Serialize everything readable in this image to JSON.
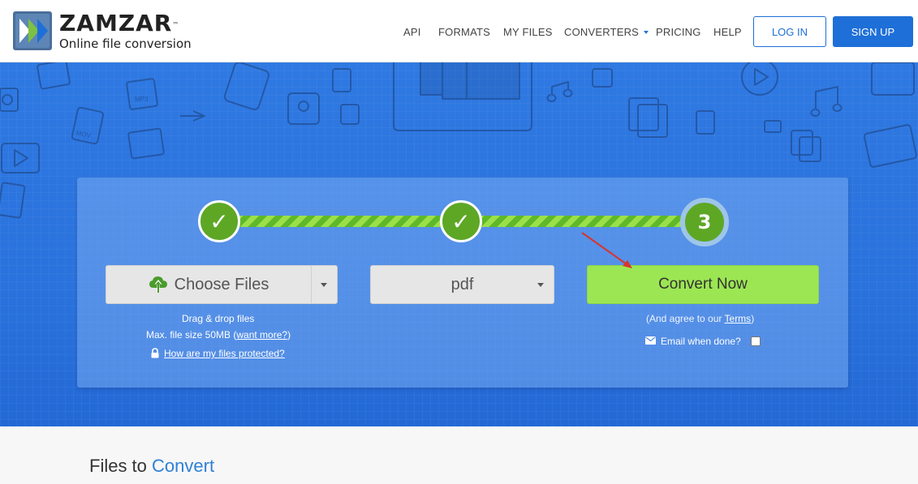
{
  "logo": {
    "name": "ZAMZAR",
    "tm": "™",
    "tagline": "Online file conversion"
  },
  "nav": {
    "items": [
      {
        "label": "API"
      },
      {
        "label": "FORMATS"
      },
      {
        "label": "MY FILES"
      },
      {
        "label": "CONVERTERS",
        "has_dropdown": true
      },
      {
        "label": "PRICING"
      },
      {
        "label": "HELP"
      }
    ],
    "login_label": "LOG IN",
    "signup_label": "SIGN UP"
  },
  "converter": {
    "steps": [
      {
        "state": "done",
        "icon": "checkmark-icon",
        "glyph": "✓"
      },
      {
        "state": "done",
        "icon": "checkmark-icon",
        "glyph": "✓"
      },
      {
        "state": "current",
        "number": "3"
      }
    ],
    "choose_files_label": "Choose Files",
    "drag_drop_text": "Drag & drop files",
    "max_size_text": "Max. file size 50MB (",
    "want_more_link": "want more?",
    "max_size_close": ")",
    "protected_link": "How are my files protected?",
    "format_value": "pdf",
    "convert_label": "Convert Now",
    "agree_prefix": "(And agree to our ",
    "terms_link": "Terms",
    "agree_suffix": ")",
    "email_label": "Email when done?",
    "email_checked": false
  },
  "files_section": {
    "title_plain": "Files to ",
    "title_accent": "Convert"
  },
  "colors": {
    "brand_blue": "#1e6fd8",
    "hero_blue": "#2a72dd",
    "convert_green": "#9ce653",
    "step_green": "#5ea725",
    "accent_text": "#2f80d8"
  }
}
